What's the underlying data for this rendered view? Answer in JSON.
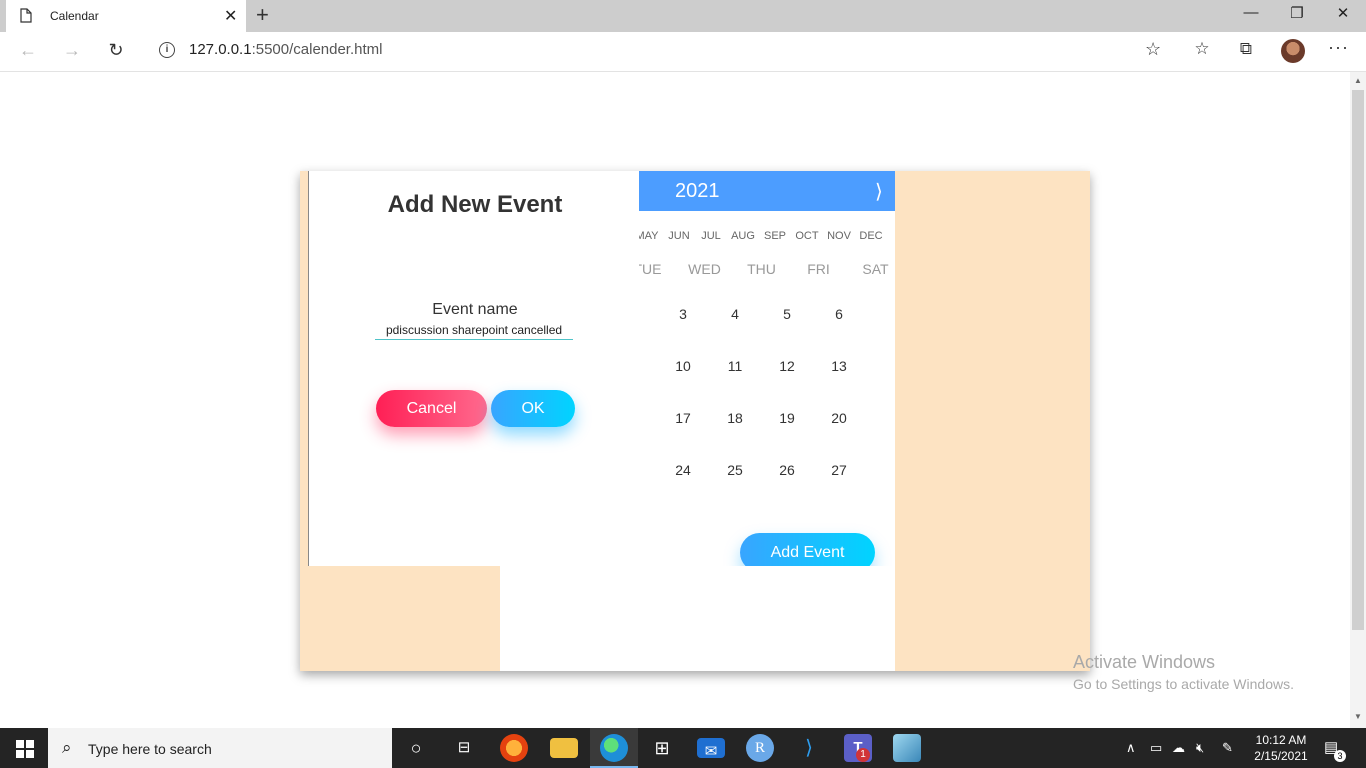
{
  "browser": {
    "tab_title": "Calendar",
    "tab_close": "✕",
    "new_tab": "+",
    "url_host": "127.0.0.1",
    "url_rest": ":5500/calender.html",
    "back_icon": "arrow-left",
    "forward_icon": "arrow-right",
    "refresh_icon": "refresh",
    "window": {
      "minimize": "—",
      "restore": "❐",
      "close": "✕"
    }
  },
  "event_form": {
    "title": "Add New Event",
    "label": "Event name",
    "value": "pdiscussion sharepoint cancelled",
    "cancel_label": "Cancel",
    "ok_label": "OK"
  },
  "calendar": {
    "year": "2021",
    "next": "⟩",
    "months": [
      "MAY",
      "JUN",
      "JUL",
      "AUG",
      "SEP",
      "OCT",
      "NOV",
      "DEC"
    ],
    "weekdays": [
      "TUE",
      "WED",
      "THU",
      "FRI",
      "SAT"
    ],
    "days": [
      "3",
      "4",
      "5",
      "6",
      "10",
      "11",
      "12",
      "13",
      "17",
      "18",
      "19",
      "20",
      "24",
      "25",
      "26",
      "27"
    ],
    "add_event_label": "Add Event"
  },
  "watermark": {
    "line1": "Activate Windows",
    "line2": "Go to Settings to activate Windows."
  },
  "taskbar": {
    "search_placeholder": "Type here to search",
    "time": "10:12 AM",
    "date": "2/15/2021",
    "notifications": "3",
    "teams_badge": "1"
  },
  "colors": {
    "header_blue": "#4c9dff",
    "card_peach": "#fde3c2",
    "cancel_pink": "#ff1f55",
    "ok_cyan": "#00d4ff"
  }
}
